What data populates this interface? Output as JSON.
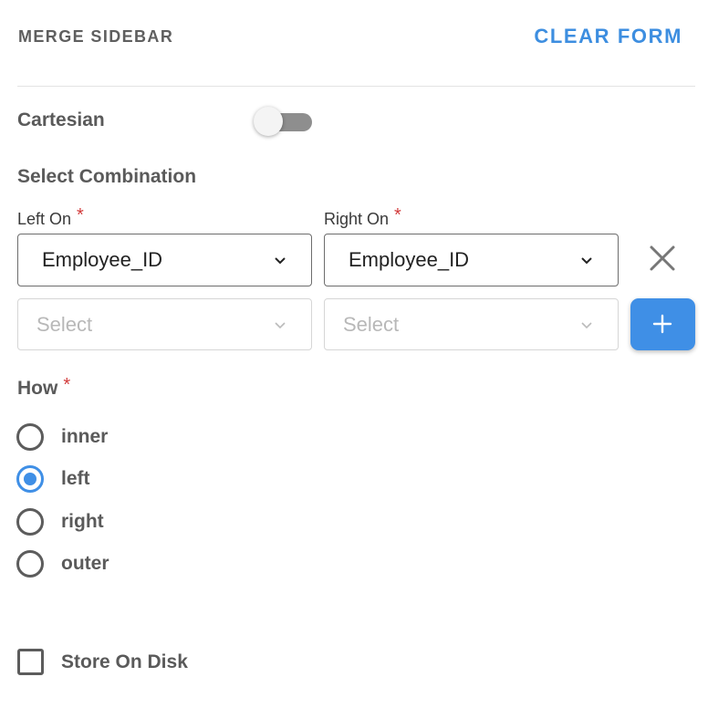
{
  "header": {
    "title": "MERGE SIDEBAR",
    "clear_label": "CLEAR FORM"
  },
  "cartesian": {
    "label": "Cartesian",
    "enabled": false
  },
  "combination": {
    "heading": "Select Combination",
    "left_label": "Left On",
    "right_label": "Right On",
    "required_mark": "*",
    "rows": [
      {
        "left_value": "Employee_ID",
        "right_value": "Employee_ID"
      },
      {
        "left_placeholder": "Select",
        "right_placeholder": "Select"
      }
    ]
  },
  "how": {
    "label": "How",
    "required_mark": "*",
    "options": [
      "inner",
      "left",
      "right",
      "outer"
    ],
    "selected": "left"
  },
  "store_on_disk": {
    "label": "Store On Disk",
    "checked": false
  },
  "colors": {
    "accent": "#3f8fe6",
    "required": "#d23b3b"
  }
}
